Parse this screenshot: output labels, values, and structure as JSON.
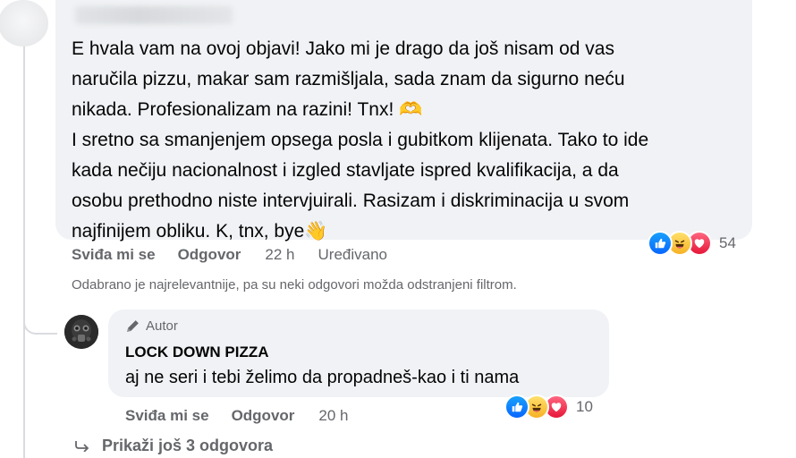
{
  "comment": {
    "text": "E hvala vam na ovoj objavi! Jako mi je drago da još nisam od vas\nnaručila pizzu, makar sam razmišljala, sada znam da sigurno neću\nnikada. Profesionalizam na razini! Tnx! 🫶\nI sretno sa smanjenjem opsega posla i gubitkom klijenata. Tako to ide\nkada nečiju nacionalnost i izgled stavljate ispred kvalifikacija, a da\nosobu prethodno niste intervjuirali. Rasizam i diskriminacija u svom\nnajfinijem obliku. K, tnx, bye👋",
    "like_label": "Sviđa mi se",
    "reply_label": "Odgovor",
    "time": "22 h",
    "edited_label": "Uređivano",
    "reaction_count": "54",
    "reactions": [
      "like",
      "haha",
      "love"
    ]
  },
  "filter_note": "Odabrano je najrelevantnije, pa su neki odgovori možda odstranjeni filtrom.",
  "reply": {
    "badge_label": "Autor",
    "author": "LOCK DOWN PIZZA",
    "text": "aj ne seri i tebi želimo da propadneš-kao i ti nama",
    "like_label": "Sviđa mi se",
    "reply_label": "Odgovor",
    "time": "20 h",
    "reaction_count": "10",
    "reactions": [
      "like",
      "haha",
      "love"
    ]
  },
  "more_replies_label": "Prikaži još 3 odgovora",
  "colors": {
    "bubble": "#f0f2f5",
    "secondary_text": "#65676b",
    "like_blue": "#0866ff",
    "love_red": "#e61739",
    "haha_yellow": "#f7b125"
  }
}
